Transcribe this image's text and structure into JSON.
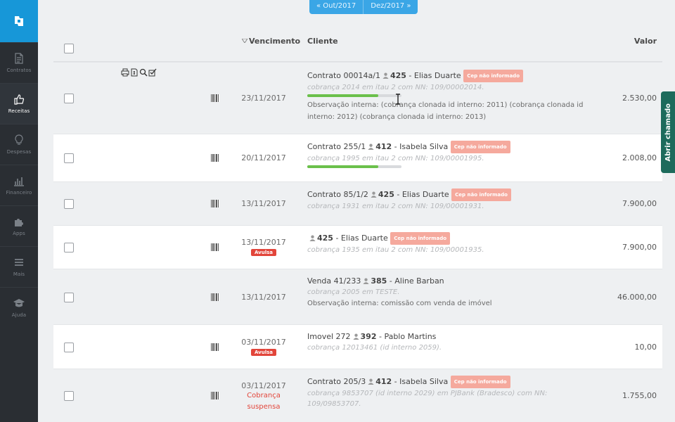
{
  "sidebar": {
    "items": [
      {
        "label": "Contratos",
        "icon": "document-icon"
      },
      {
        "label": "Receitas",
        "icon": "thumbs-up-icon"
      },
      {
        "label": "Despesas",
        "icon": "lightbulb-icon"
      },
      {
        "label": "Financeiro",
        "icon": "bar-chart-icon"
      },
      {
        "label": "Apps",
        "icon": "puzzle-icon"
      },
      {
        "label": "Mais",
        "icon": "menu-icon"
      },
      {
        "label": "Ajuda",
        "icon": "graduation-cap-icon"
      }
    ],
    "active": "Receitas"
  },
  "period_nav": {
    "prev": "« Out/2017",
    "next": "Dez/2017 »"
  },
  "table": {
    "headers": {
      "vencimento": "Vencimento",
      "cliente": "Cliente",
      "valor": "Valor"
    },
    "rows": [
      {
        "date": "23/11/2017",
        "prefix": "Contrato 00014a/1",
        "client_id": "425",
        "client_name": " - Elias Duarte",
        "cep": "Cep não informado",
        "info": "cobrança 2014 em itau 2 com NN: 109/00002014.",
        "progress": 0.75,
        "obs": "Observação interna: (cobrança clonada id interno: 2011) (cobrança clonada id interno: 2012) (cobrança clonada id interno: 2013)",
        "value": "2.530,00"
      },
      {
        "date": "20/11/2017",
        "prefix": "Contrato 255/1",
        "client_id": "412",
        "client_name": " - Isabela Silva",
        "cep": "Cep não informado",
        "info": "cobrança 1995 em itau 2 com NN: 109/00001995.",
        "progress": 0.75,
        "value": "2.008,00"
      },
      {
        "date": "13/11/2017",
        "prefix": "Contrato 85/1/2",
        "client_id": "425",
        "client_name": " - Elias Duarte",
        "cep": "Cep não informado",
        "info": "cobrança 1931 em itau 2 com NN: 109/00001931.",
        "value": "7.900,00"
      },
      {
        "date": "13/11/2017",
        "tag": "Avulsa",
        "client_id": "425",
        "client_name": " - Elias Duarte",
        "cep": "Cep não informado",
        "info": "cobrança 1935 em itau 2 com NN: 109/00001935.",
        "value": "7.900,00"
      },
      {
        "date": "13/11/2017",
        "prefix": "Venda 41/233",
        "client_id": "385",
        "client_name": " - Aline Barban",
        "info": "cobrança 2005 em TESTE.",
        "obs": "Observação interna: comissão com venda de imóvel",
        "value": "46.000,00"
      },
      {
        "date": "03/11/2017",
        "tag": "Avulsa",
        "prefix": "Imovel 272",
        "client_id": "392",
        "client_name": " - Pablo Martins",
        "info": "cobrança 12013461 (id interno 2059).",
        "value": "10,00"
      },
      {
        "date": "03/11/2017",
        "status": "Cobrança suspensa",
        "prefix": "Contrato 205/3",
        "client_id": "412",
        "client_name": " - Isabela Silva",
        "cep": "Cep não informado",
        "info": "cobrança 9853707 (id interno 2029) em PJBank (Bradesco) com NN: 109/09853707.",
        "value": "1.755,00"
      }
    ]
  },
  "side_tab": "Abrir chamado",
  "colors": {
    "sidebar": "#2a2e33",
    "logo_bg": "#1797d8",
    "nav_blue": "#3aa6e6",
    "progress": "#6bc04b",
    "cep_tag": "#f5a99d",
    "alert_red": "#e2453a",
    "side_tab": "#1d6b5c"
  }
}
